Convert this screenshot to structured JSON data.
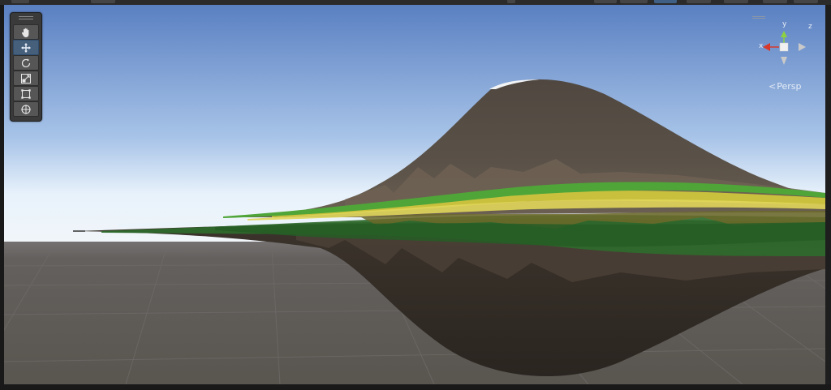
{
  "window": {
    "title": ""
  },
  "toolbar": {
    "tools": [
      {
        "name": "hand-tool",
        "icon": "hand-icon",
        "active": false
      },
      {
        "name": "move-tool",
        "icon": "move-icon",
        "active": true
      },
      {
        "name": "rotate-tool",
        "icon": "rotate-icon",
        "active": false
      },
      {
        "name": "scale-tool",
        "icon": "scale-icon",
        "active": false
      },
      {
        "name": "rect-tool",
        "icon": "rect-icon",
        "active": false
      },
      {
        "name": "transform-tool",
        "icon": "transform-icon",
        "active": false
      }
    ]
  },
  "gizmo": {
    "x_label": "x",
    "y_label": "y",
    "z_label": "z",
    "projection_label": "Persp",
    "projection_chevron": "<",
    "colors": {
      "x": "#d6382c",
      "y": "#8ed13f",
      "z": "#3b6fd3",
      "neutral": "#c9c9c9"
    }
  },
  "scene": {
    "sky_top": "#5a80c2",
    "horizon": "#e8f2fb",
    "ground": "#5b5755",
    "terrain_dark": "#3a342e",
    "terrain_mid": "#5b5248",
    "grass": "#2f6a2b",
    "grass_light": "#4fa538",
    "sand": "#c9c13e"
  }
}
